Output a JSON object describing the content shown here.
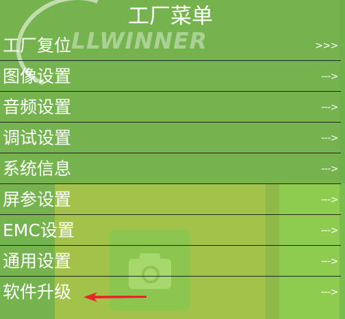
{
  "header": {
    "title": "工厂菜单"
  },
  "logo": {
    "text": "LLWINNER"
  },
  "menu": {
    "items": [
      {
        "label": "工厂复位",
        "arrow": ">>>"
      },
      {
        "label": "图像设置",
        "arrow": "--->"
      },
      {
        "label": "音频设置",
        "arrow": "--->"
      },
      {
        "label": "调试设置",
        "arrow": "--->"
      },
      {
        "label": "系统信息",
        "arrow": "--->"
      },
      {
        "label": "屏参设置",
        "arrow": "--->"
      },
      {
        "label": "EMC设置",
        "arrow": "--->"
      },
      {
        "label": "通用设置",
        "arrow": "--->"
      },
      {
        "label": "软件升级",
        "arrow": "--->"
      }
    ]
  },
  "annotation": {
    "color": "#e8262a",
    "icon": "red-arrow-icon"
  },
  "colors": {
    "background": "#74b34d",
    "text": "#ffffff",
    "divider": "#222222"
  }
}
